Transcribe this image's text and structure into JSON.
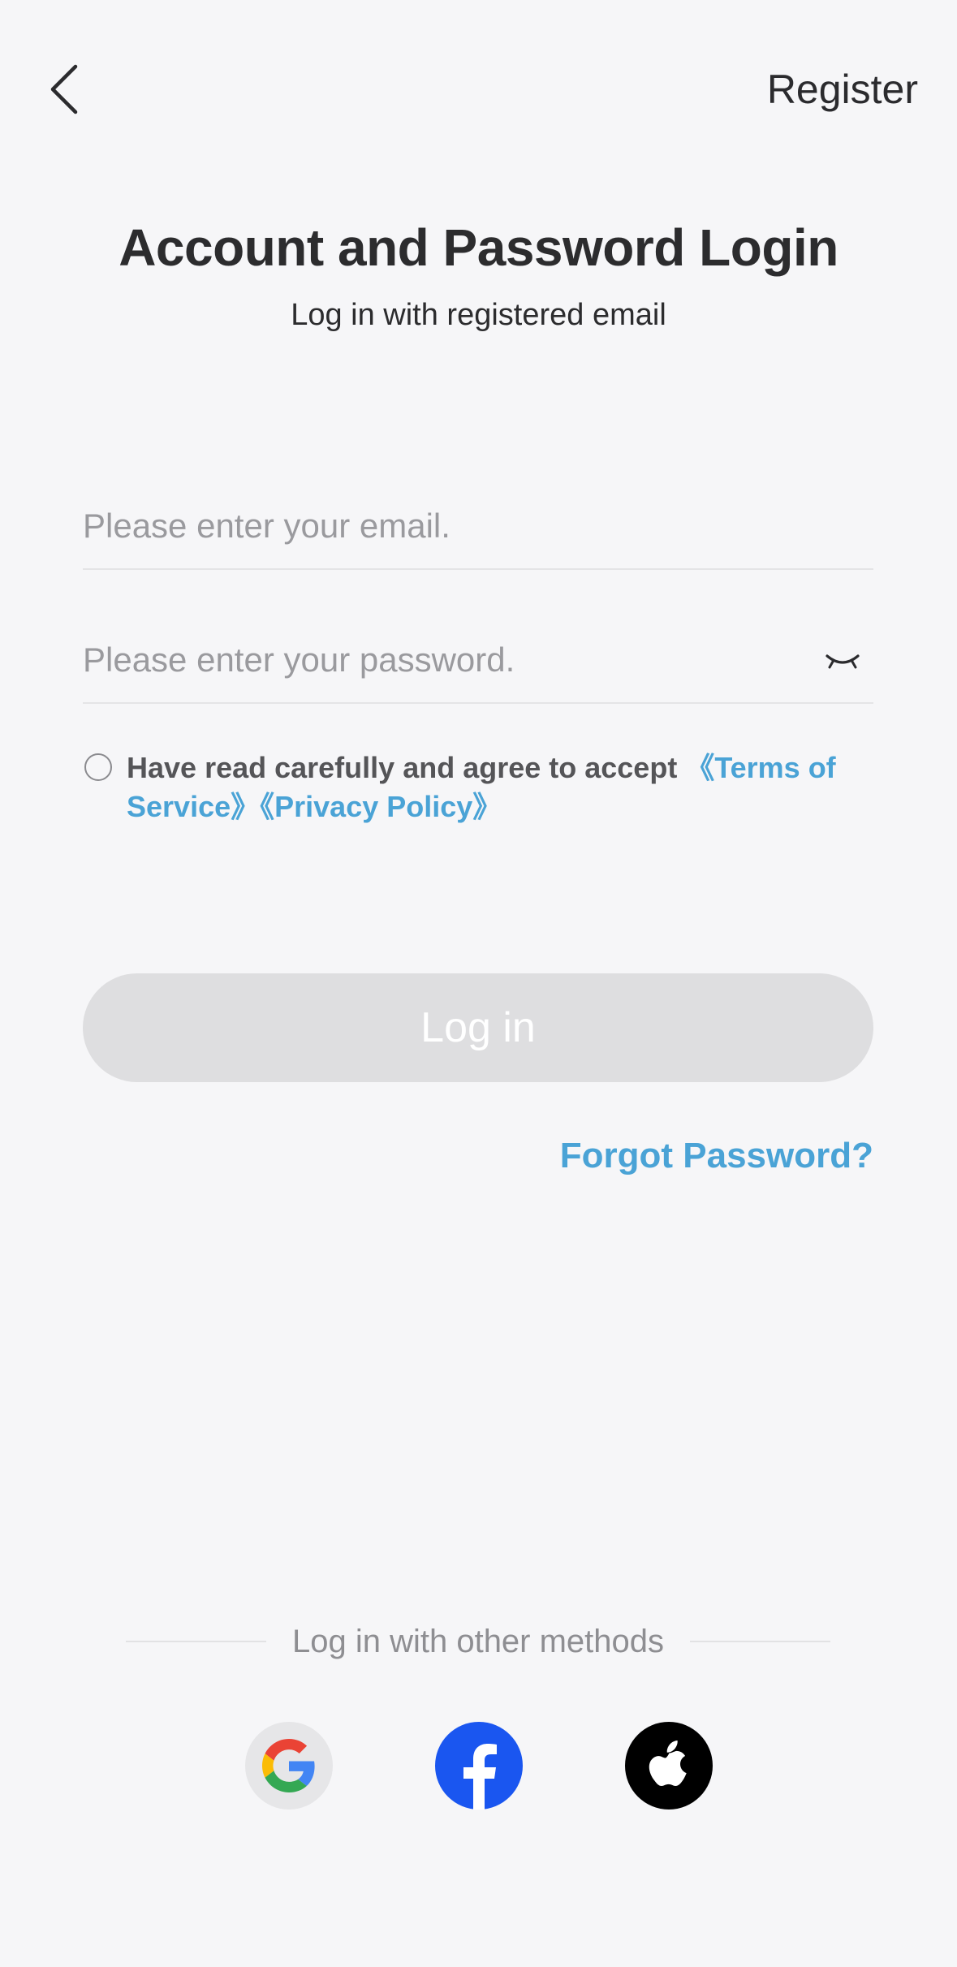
{
  "nav": {
    "back_icon": "chevron-left-icon",
    "register_label": "Register"
  },
  "header": {
    "title": "Account and Password Login",
    "subtitle": "Log in with registered email"
  },
  "form": {
    "email_placeholder": "Please enter your email.",
    "email_value": "",
    "password_placeholder": "Please enter your password.",
    "password_value": "",
    "password_toggle_icon": "eye-closed-icon"
  },
  "agreement": {
    "checked": false,
    "prefix": "Have read carefully and agree to accept ",
    "terms_label": "《Terms of Service》",
    "privacy_label": "《Privacy Policy》"
  },
  "actions": {
    "login_label": "Log in",
    "forgot_label": "Forgot Password?"
  },
  "other_methods": {
    "label": "Log in with other methods",
    "providers": [
      {
        "name": "google-icon",
        "color": "#e6e6e8"
      },
      {
        "name": "facebook-icon",
        "color": "#1a56f0"
      },
      {
        "name": "apple-icon",
        "color": "#000000"
      }
    ]
  },
  "colors": {
    "background": "#f6f6f8",
    "link_blue": "#4aa3d6",
    "button_disabled": "#dedee0",
    "text_dark": "#2c2c2e",
    "placeholder": "#9a9a9e"
  }
}
